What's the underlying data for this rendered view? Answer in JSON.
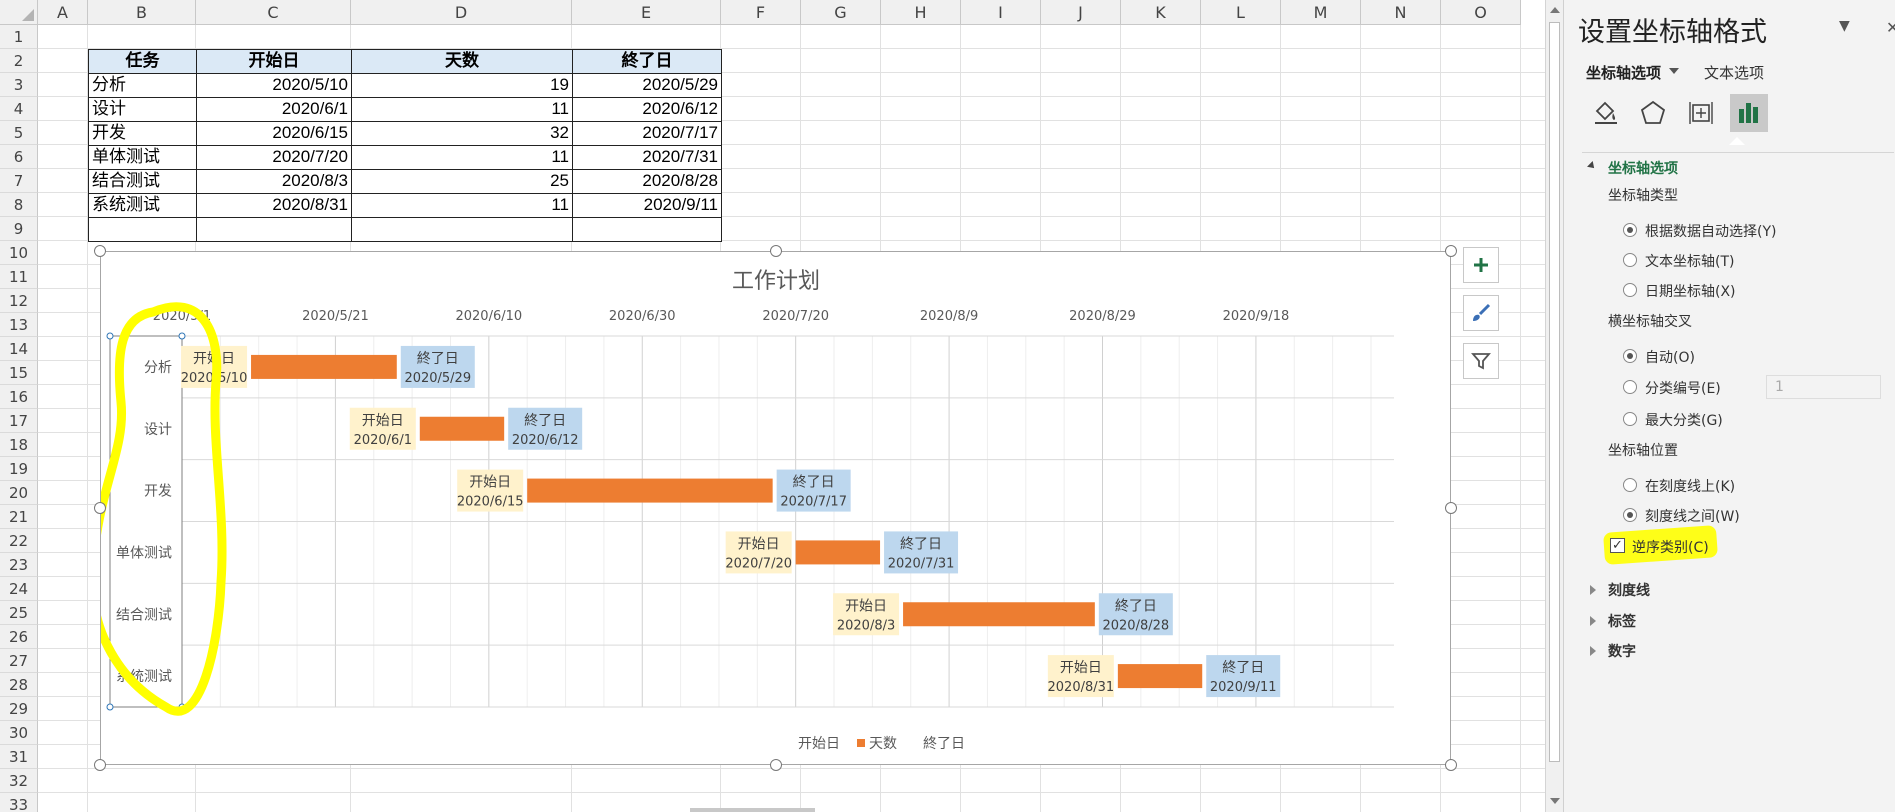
{
  "spreadsheet": {
    "columns": [
      "A",
      "B",
      "C",
      "D",
      "E",
      "F",
      "G",
      "H",
      "I",
      "J",
      "K",
      "L",
      "M",
      "N",
      "O"
    ],
    "rows": [
      "1",
      "2",
      "3",
      "4",
      "5",
      "6",
      "7",
      "8",
      "9",
      "10",
      "11",
      "12",
      "13",
      "14",
      "15",
      "16",
      "17",
      "18",
      "19",
      "20",
      "21",
      "22",
      "23",
      "24",
      "25",
      "26",
      "27",
      "28",
      "29",
      "30",
      "31",
      "32",
      "33"
    ],
    "table": {
      "headers": [
        "任务",
        "开始日",
        "天数",
        "終了日"
      ],
      "rows": [
        [
          "分析",
          "2020/5/10",
          "19",
          "2020/5/29"
        ],
        [
          "设计",
          "2020/6/1",
          "11",
          "2020/6/12"
        ],
        [
          "开发",
          "2020/6/15",
          "32",
          "2020/7/17"
        ],
        [
          "单体测试",
          "2020/7/20",
          "11",
          "2020/7/31"
        ],
        [
          "结合测试",
          "2020/8/3",
          "25",
          "2020/8/28"
        ],
        [
          "系统测试",
          "2020/8/31",
          "11",
          "2020/9/11"
        ]
      ]
    }
  },
  "chart_data": {
    "type": "bar",
    "orientation": "horizontal",
    "stacked": true,
    "title": "工作计划",
    "categories": [
      "分析",
      "设计",
      "开发",
      "单体测试",
      "结合测试",
      "系统测试"
    ],
    "x_ticks": [
      "2020/5/1",
      "2020/5/21",
      "2020/6/10",
      "2020/6/30",
      "2020/7/20",
      "2020/8/9",
      "2020/8/29",
      "2020/9/18"
    ],
    "xlim": [
      "2020/5/1",
      "2020/10/6"
    ],
    "x_axis_position": "top",
    "categories_reversed": true,
    "grid": true,
    "series": [
      {
        "name": "开始日",
        "values": [
          "2020/5/10",
          "2020/6/1",
          "2020/6/15",
          "2020/7/20",
          "2020/8/3",
          "2020/8/31"
        ],
        "visible": false,
        "label_color": "#fff2cc"
      },
      {
        "name": "天数",
        "values": [
          19,
          11,
          32,
          11,
          25,
          11
        ],
        "color": "#ed7d31"
      },
      {
        "name": "終了日",
        "values": [
          "2020/5/29",
          "2020/6/12",
          "2020/7/17",
          "2020/7/31",
          "2020/8/28",
          "2020/9/11"
        ],
        "visible": false,
        "label_color": "#bdd7ee"
      }
    ],
    "legend": "bottom",
    "data_label_prefix_start": "开始日",
    "data_label_prefix_end": "終了日"
  },
  "chart_buttons": {
    "add": "plus-icon",
    "style": "brush-icon",
    "filter": "filter-icon"
  },
  "pane": {
    "title": "设置坐标轴格式",
    "tabs": [
      "坐标轴选项",
      "文本选项"
    ],
    "icons": [
      "fill-bucket-icon",
      "pentagon-icon",
      "size-properties-icon",
      "bar-chart-icon"
    ],
    "section_open": "坐标轴选项",
    "axis_type_label": "坐标轴类型",
    "axis_type_options": [
      "根据数据自动选择(Y)",
      "文本坐标轴(T)",
      "日期坐标轴(X)"
    ],
    "axis_type_selected": 0,
    "cross_label": "横坐标轴交叉",
    "cross_options": [
      "自动(O)",
      "分类编号(E)",
      "最大分类(G)"
    ],
    "cross_selected": 0,
    "cross_number_value": "1",
    "position_label": "坐标轴位置",
    "position_options": [
      "在刻度线上(K)",
      "刻度线之间(W)"
    ],
    "position_selected": 1,
    "reverse_label": "逆序类别(C)",
    "reverse_checked": true,
    "collapsed_sections": [
      "刻度线",
      "标签",
      "数字"
    ]
  }
}
